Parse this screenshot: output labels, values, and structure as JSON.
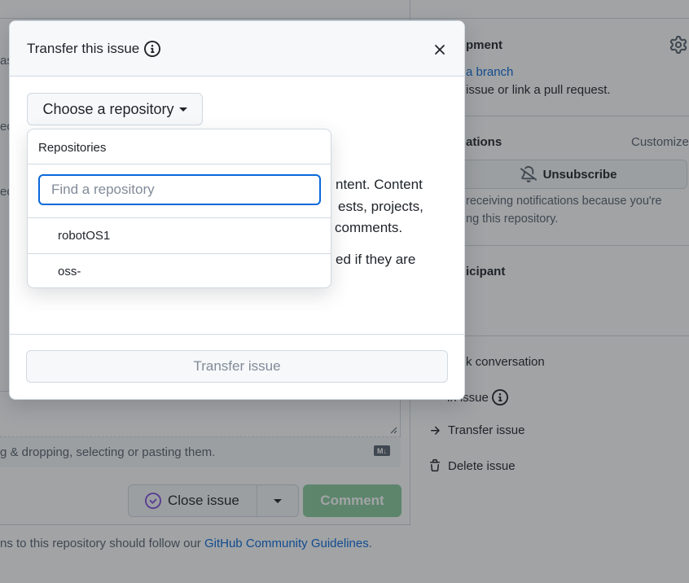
{
  "background": {
    "left_fragments": [
      "as",
      "ed",
      "ed"
    ],
    "development": {
      "heading": "pment",
      "link": "a branch",
      "text": "issue or link a pull request."
    },
    "notifications": {
      "heading": "ations",
      "customize": "Customize",
      "unsubscribe_label": "Unsubscribe",
      "text1": "receiving notifications because you're",
      "text2": "ng this repository."
    },
    "participants": {
      "heading": "icipant"
    },
    "actions": {
      "lock": "k conversation",
      "pin": "in issue",
      "transfer": "Transfer issue",
      "delete": "Delete issue"
    },
    "editor": {
      "hint": "g & dropping, selecting or pasting them.",
      "md_badge": "M↓"
    },
    "close_issue_label": "Close issue",
    "comment_label": "Comment",
    "guidelines": {
      "prefix": "ns to this repository should follow our ",
      "link": "GitHub Community Guidelines",
      "suffix": "."
    }
  },
  "dialog": {
    "title": "Transfer this issue",
    "choose_label": "Choose a repository",
    "body_lines": [
      "ntent. Content",
      "ests, projects,",
      "comments.",
      "ed if they are"
    ],
    "transfer_button": "Transfer issue"
  },
  "dropdown": {
    "title": "Repositories",
    "search_placeholder": "Find a repository",
    "search_value": "",
    "items": [
      "robotOS1",
      "oss-"
    ]
  },
  "colors": {
    "accent": "#0969da",
    "success": "#2da44e",
    "border": "#d1d9e0",
    "muted": "#59636e"
  }
}
